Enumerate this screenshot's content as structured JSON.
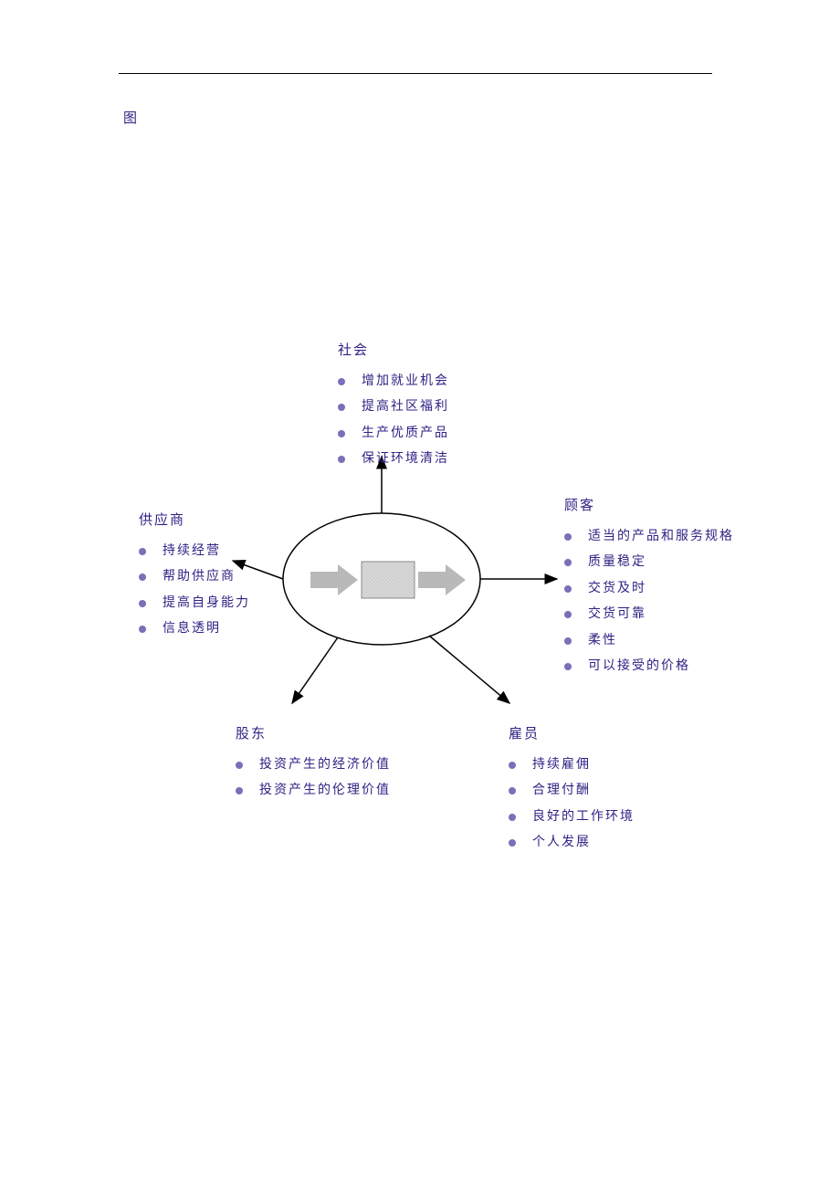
{
  "caption": "图",
  "groups": {
    "society": {
      "title": "社会",
      "items": [
        "增加就业机会",
        "提高社区福利",
        "生产优质产品",
        "保证环境清洁"
      ]
    },
    "supplier": {
      "title": "供应商",
      "items": [
        "持续经营",
        "帮助供应商",
        "提高自身能力",
        "信息透明"
      ]
    },
    "customer": {
      "title": "顾客",
      "items": [
        "适当的产品和服务规格",
        "质量稳定",
        "交货及时",
        "交货可靠",
        "柔性",
        "可以接受的价格"
      ]
    },
    "shareholder": {
      "title": "股东",
      "items": [
        "投资产生的经济价值",
        "投资产生的伦理价值"
      ]
    },
    "employee": {
      "title": "雇员",
      "items": [
        "持续雇佣",
        "合理付酬",
        "良好的工作环境",
        "个人发展"
      ]
    }
  }
}
